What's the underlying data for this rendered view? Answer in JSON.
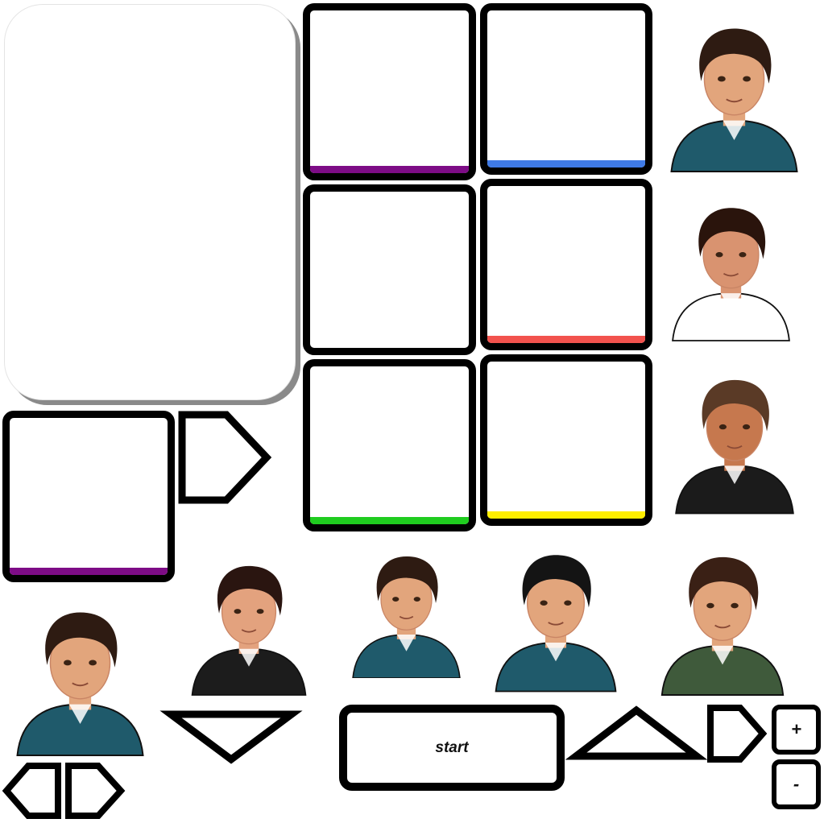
{
  "dialogue_panel": {
    "text": ""
  },
  "slots": [
    {
      "name": "slot-purple-top",
      "bar_color": "#7d0c86"
    },
    {
      "name": "slot-blue",
      "bar_color": "#3f7ae6"
    },
    {
      "name": "slot-empty-mid",
      "bar_color": ""
    },
    {
      "name": "slot-red",
      "bar_color": "#f2524d"
    },
    {
      "name": "slot-green",
      "bar_color": "#1fcc1f"
    },
    {
      "name": "slot-yellow",
      "bar_color": "#ffef00"
    },
    {
      "name": "slot-purple-selected",
      "bar_color": "#7d0c86"
    }
  ],
  "characters": [
    {
      "id": "curly-boy-pointing",
      "hair": "#2e1b12",
      "skin": "#e2a57c",
      "outfit": "#1f5a6b"
    },
    {
      "id": "long-haired-girl",
      "hair": "#2a140c",
      "skin": "#d99370",
      "outfit": "#ffffff"
    },
    {
      "id": "winking-boy",
      "hair": "#5a3a26",
      "skin": "#c6784e",
      "outfit": "#1b1b1b"
    },
    {
      "id": "boy-gold-chain",
      "hair": "#2a1510",
      "skin": "#e3a27e",
      "outfit": "#1c1c1c"
    },
    {
      "id": "black-haired-boy",
      "hair": "#141414",
      "skin": "#e2a57c",
      "outfit": "#1f5a6b"
    },
    {
      "id": "green-sweater-boy",
      "hair": "#3a2015",
      "skin": "#e2a57c",
      "outfit": "#3f5a3b"
    }
  ],
  "controls": {
    "start_label": "start",
    "plus_label": "+",
    "minus_label": "-",
    "next_icon": "arrow-right-icon",
    "prev_icon": "arrow-left-icon",
    "down_icon": "triangle-down-icon",
    "up_icon": "triangle-up-icon"
  },
  "colors": {
    "outline": "#000000",
    "panel_shadow": "#8a8a8a",
    "skin_shade": "#c98565"
  }
}
